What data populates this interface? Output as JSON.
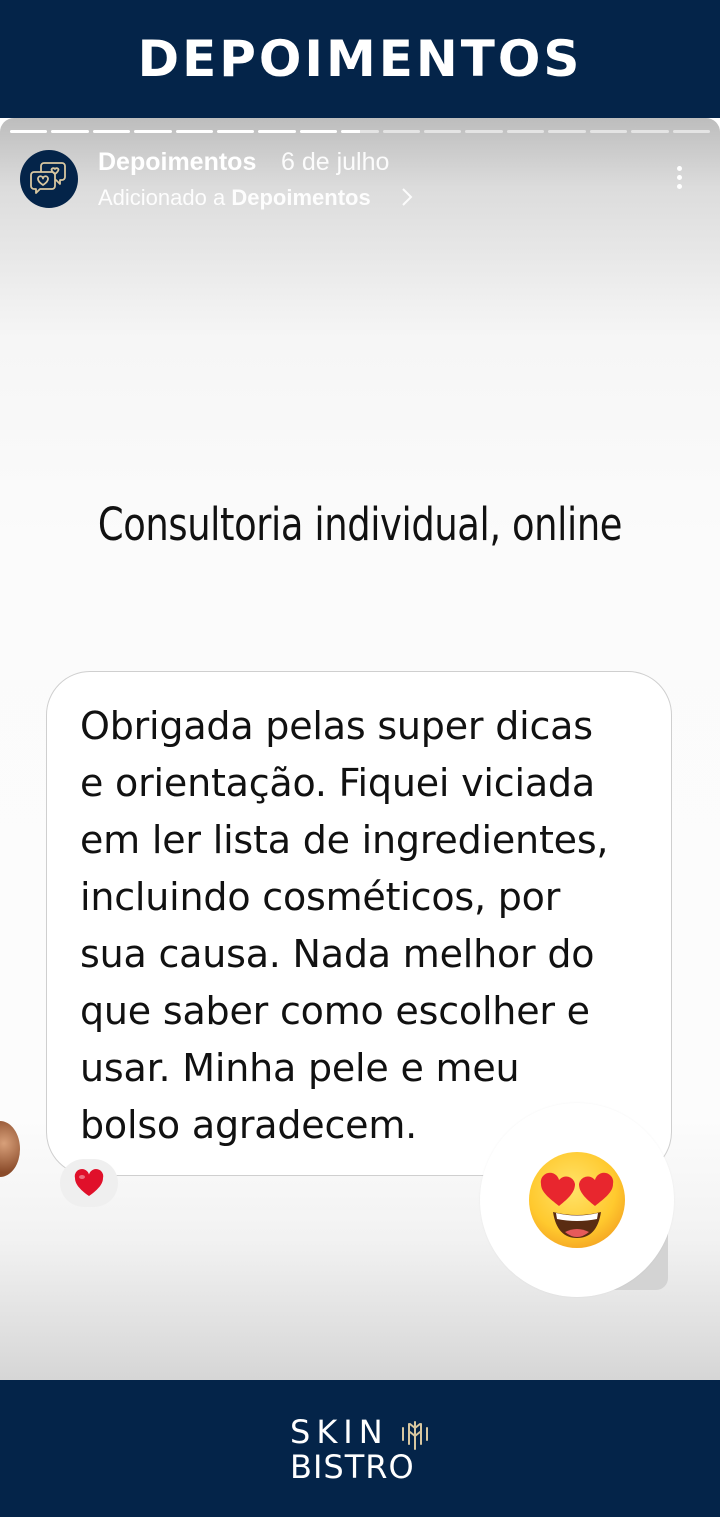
{
  "banner": {
    "title": "DEPOIMENTOS"
  },
  "story": {
    "progress": {
      "total_segments": 17,
      "completed_segments": 8.5
    },
    "account_name": "Depoimentos",
    "date": "6 de julho",
    "added_prefix": "Adicionado a",
    "added_highlight": "Depoimentos",
    "icons": {
      "avatar": "chat-hearts-icon",
      "chevron": "chevron-right-icon",
      "menu": "more-vertical-icon"
    }
  },
  "content": {
    "headline": "Consultoria individual, online",
    "message": "Obrigada pelas super dicas\ne orientação. Fiquei viciada\nem ler lista de ingredientes,\nincluindo cosméticos, por\nsua causa. Nada melhor do\nque saber como escolher e\nusar. Minha pele e meu\nbolso agradecem.",
    "reaction_icon": "heart-icon",
    "sticker_icon": "heart-eyes-emoji-icon"
  },
  "footer": {
    "logo_line1": "SKIN",
    "logo_line2": "BISTRO",
    "logo_icon": "wheat-icon"
  },
  "colors": {
    "brand_navy": "#042449",
    "heart_red": "#e0102a",
    "emoji_yellow": "#ffcc33"
  }
}
